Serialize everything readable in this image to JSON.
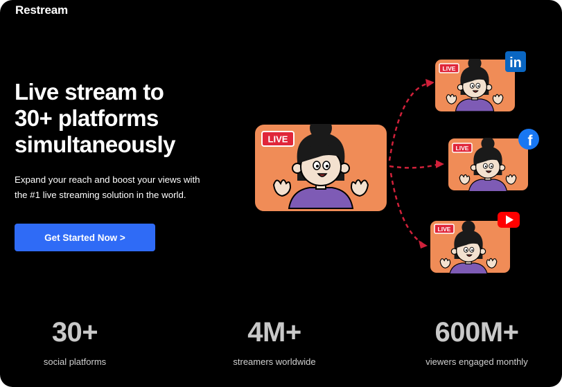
{
  "brand": {
    "name": "Restream"
  },
  "hero": {
    "headline_lines": [
      "Live stream to",
      "30+ platforms",
      "simultaneously"
    ],
    "subtitle_lines": [
      "Expand your reach and boost your views with",
      "the #1 live streaming solution in the world."
    ],
    "cta_label": "Get Started Now >"
  },
  "illustration": {
    "live_badge": "LIVE",
    "destinations": [
      {
        "platform": "linkedin",
        "icon": "linkedin-icon",
        "icon_text": "in"
      },
      {
        "platform": "facebook",
        "icon": "facebook-icon",
        "icon_text": "f"
      },
      {
        "platform": "youtube",
        "icon": "youtube-icon"
      }
    ]
  },
  "stats": [
    {
      "value": "30+",
      "label": "social platforms"
    },
    {
      "value": "4M+",
      "label": "streamers worldwide"
    },
    {
      "value": "600M+",
      "label": "viewers engaged monthly"
    }
  ],
  "colors": {
    "background": "#000000",
    "accent": "#2f6bf6",
    "card": "#f08c57",
    "live_badge": "#e0263a",
    "arrow": "#d0213a",
    "shirt": "#7e5bb5"
  }
}
